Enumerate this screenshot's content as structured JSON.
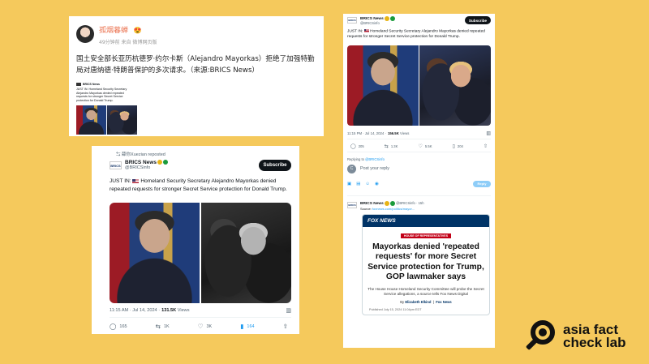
{
  "weibo": {
    "username": "孤烟暮蝉",
    "vip_badge": "😍",
    "meta": "49分钟前 来自 微博网页版",
    "text": "国土安全部长亚历杭德罗·约尔卡斯（Alejandro Mayorkas）拒绝了加强特勤局对唐纳德·特朗普保护的多次请求。（来源:BRICS News）",
    "thumb": {
      "name": "BRICS News",
      "handle": "@BRICSinfo",
      "text": "JUST IN: Homeland Security Secretary Alejandro Mayorkas denied repeated requests for stronger Secret Service protection for Donald Trump."
    }
  },
  "tweet_main": {
    "repost_label": "薛你Xuezian reposted",
    "logo_text": "BRICS",
    "name": "BRICS News",
    "handle": "@BRICSinfo",
    "subscribe": "Subscribe",
    "text_prefix": "JUST IN:",
    "text": "Homeland Security Secretary Alejandro Mayorkas denied repeated requests for stronger Secret Service protection for Donald Trump.",
    "timestamp": "11:15 AM · Jul 14, 2024 ·",
    "views_count": "131.5K",
    "views_label": "Views",
    "replies": "165",
    "reposts": "1K",
    "likes": "3K",
    "bookmarks": "164"
  },
  "tweet_right": {
    "logo_text": "BRICS",
    "name": "BRICS News",
    "handle": "@BRICSinfo",
    "subscribe": "Subscribe",
    "text_prefix": "JUST IN:",
    "text": "Homeland Security Secretary Alejandro Mayorkas denied repeated requests for stronger Secret Service protection for Donald Trump.",
    "timestamp": "11:15 PM · Jul 14, 2024 ·",
    "views_count": "156.5K",
    "views_label": "Views",
    "replies": "205",
    "reposts": "1.3K",
    "likes": "5.5K",
    "bookmarks": "204",
    "replying_prefix": "Replying to",
    "replying_handle": "@BRICSinfo",
    "reply_placeholder": "Post your reply",
    "reply_avatar": "C",
    "reply_button": "Reply",
    "reply_tweet": {
      "name": "BRICS News",
      "handle": "@BRICSinfo · 15h",
      "source_label": "Source:",
      "source_link": "foxnews.com/politics/mayor..."
    },
    "fox": {
      "brand": "FOX NEWS",
      "tag": "HOUSE OF REPRESENTATIVES",
      "headline": "Mayorkas denied 'repeated requests' for more Secret Service protection for Trump, GOP lawmaker says",
      "subhead": "The House House Homeland Security Committee will probe the Secret Service allegations, a source tells Fox News Digital",
      "by_label": "By",
      "author": "Elizabeth Elkind",
      "outlet": "Fox News",
      "published": "Published July 15, 2024 11:04pm EDT"
    }
  },
  "logo": {
    "line1": "asia fact",
    "line2": "check lab"
  }
}
